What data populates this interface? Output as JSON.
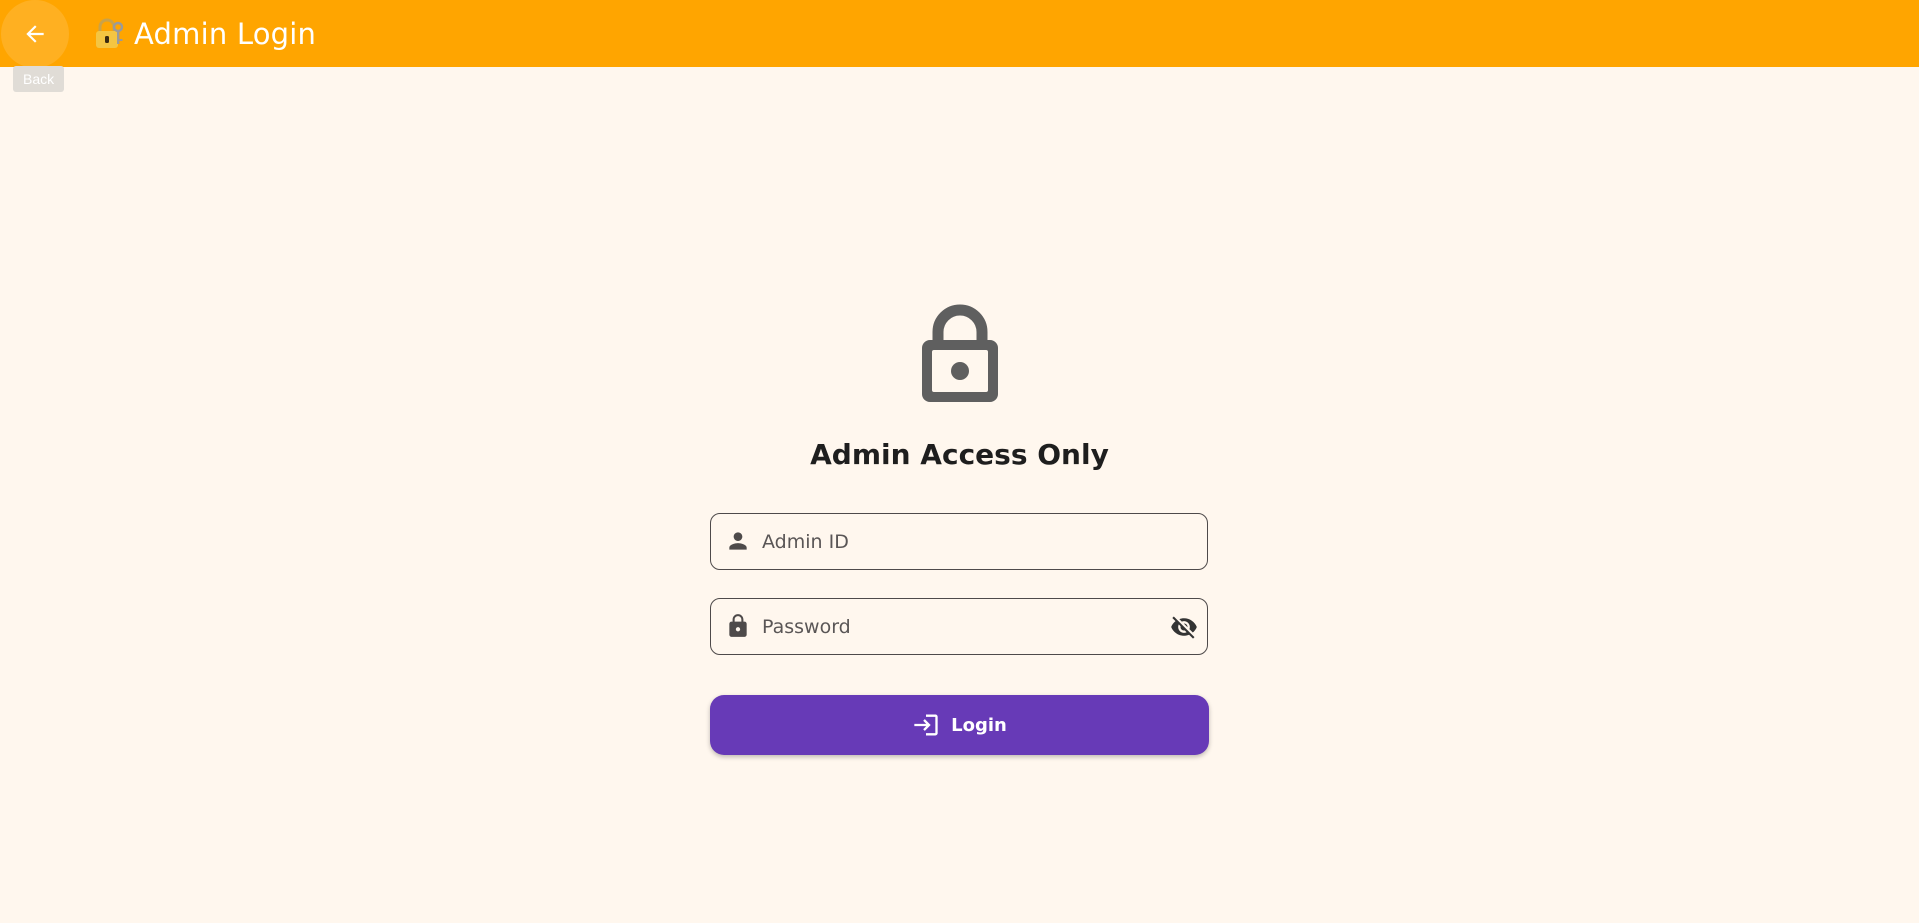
{
  "appbar": {
    "title": "Admin Login",
    "title_icon": "lock-with-key-emoji",
    "back_icon": "arrow-left-icon",
    "back_tooltip": "Back",
    "background_color": "#FFA500"
  },
  "main": {
    "hero_icon": "lock-icon",
    "heading": "Admin Access Only",
    "admin_id_field": {
      "placeholder": "Admin ID",
      "value": "",
      "icon": "person-icon"
    },
    "password_field": {
      "placeholder": "Password",
      "value": "",
      "icon": "lock-icon",
      "visibility_icon": "visibility-off-icon"
    },
    "login_button": {
      "label": "Login",
      "icon": "login-icon",
      "color": "#673AB7"
    }
  },
  "colors": {
    "page_background": "#FFF7EE",
    "accent": "#FFA500",
    "primary": "#673AB7"
  }
}
